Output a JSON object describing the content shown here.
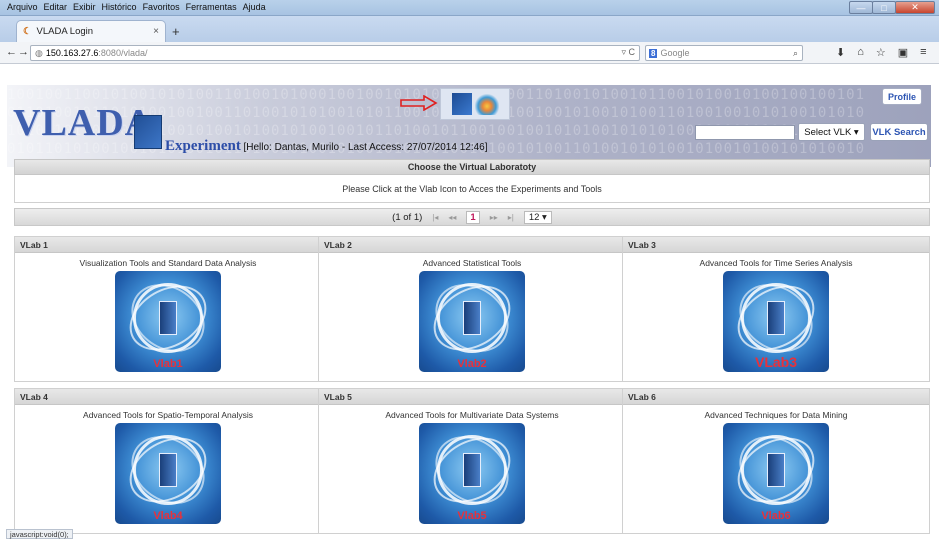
{
  "menu": [
    "Arquivo",
    "Editar",
    "Exibir",
    "Histórico",
    "Favoritos",
    "Ferramentas",
    "Ajuda"
  ],
  "tab": {
    "title": "VLADA Login",
    "close": "×",
    "new": "+"
  },
  "nav": {
    "back": "←",
    "forward": "→",
    "url_host": "150.163.27.6",
    "url_rest": ":8080/vlada/",
    "url_right": "▿ C",
    "search_engine": "8",
    "search_placeholder": "Google",
    "search_icon": "⌕",
    "icons": [
      "⬇",
      "⌂",
      "☆",
      "▣",
      "≡"
    ]
  },
  "header": {
    "logo": "VLADA",
    "experiment": "Experiment",
    "hello": "[Hello: Dantas, Murilo - Last Access: 27/07/2014 12:46]",
    "profile": "Profile",
    "select_vlk": "Select VLK",
    "vlk_search": "VLK Search",
    "binary_rows": [
      "1001001100101001010100110100101000100100101010001010100110100101001011001010010100100100101",
      "0110100101101010010010011010010101001010110010100101010010010100101001101001001010100101010",
      "1010010110100110100101001010010100100101101001011001001001010100101010100101001010010100100",
      "0101101010010010101001011010010100101001010100100101001010011010010101001010010100101010010"
    ]
  },
  "choose": {
    "title": "Choose the Virtual Laboratoty",
    "instruction": "Please Click at the Vlab Icon to Acces the Experiments and Tools"
  },
  "paginator": {
    "info": "(1 of 1)",
    "first": "|◂",
    "prev": "◂◂",
    "current": "1",
    "next": "▸▸",
    "last": "▸|",
    "rows": "12 ▾"
  },
  "labs": [
    {
      "title": "VLab 1",
      "desc": "Visualization Tools and Standard Data Analysis",
      "name": "Vlab1"
    },
    {
      "title": "VLab 2",
      "desc": "Advanced Statistical Tools",
      "name": "Vlab2"
    },
    {
      "title": "VLab 3",
      "desc": "Advanced Tools for Time Series Analysis",
      "name": "VLab3"
    },
    {
      "title": "VLab 4",
      "desc": "Advanced Tools for Spatio-Temporal Analysis",
      "name": "Vlab4"
    },
    {
      "title": "VLab 5",
      "desc": "Advanced Tools for Multivariate Data Systems",
      "name": "Vlab5"
    },
    {
      "title": "VLab 6",
      "desc": "Advanced Techniques for Data Mining",
      "name": "Vlab6"
    }
  ],
  "status": "javascript:void(0);",
  "colors": {
    "accent": "#2d55b3",
    "logo": "#3f5fae",
    "lab_name": "#e8313b"
  }
}
